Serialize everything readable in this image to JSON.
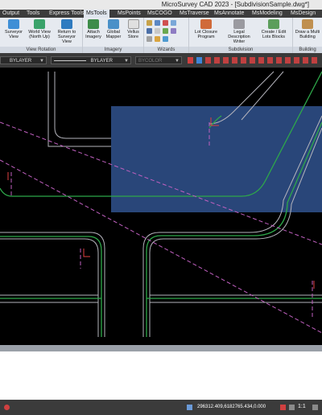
{
  "window": {
    "title": "MicroSurvey CAD 2023 - [SubdivisionSample.dwg*]"
  },
  "ribbon_tabs": [
    "Output",
    "Tools",
    "Express Tools",
    "MsTools",
    "MsPoints",
    "MsCOGO",
    "MsTraverse",
    "MsAnnotate",
    "MsModeling",
    "MsDesign"
  ],
  "active_tab": "MsTools",
  "ribbon": {
    "view_rotation": {
      "title": "View Rotation",
      "buttons": [
        "Surveyor View",
        "World View (North Up)",
        "Return to Surveyor View"
      ]
    },
    "imagery": {
      "title": "Imagery",
      "buttons": [
        "Attach Imagery",
        "Global Mapper",
        "Vellus Store"
      ]
    },
    "wizards": {
      "title": "Wizards"
    },
    "subdivision": {
      "title": "Subdivision",
      "buttons": [
        "Lot Closure Program",
        "Legal Description Writer",
        "Create / Edit Lots Blocks"
      ]
    },
    "building": {
      "title": "Building",
      "buttons": [
        "Draw a Multi Building"
      ]
    }
  },
  "properties": {
    "layer": "BYLAYER",
    "linetype": "BYLAYER",
    "color": "BYCOLOR"
  },
  "status": {
    "coordinates": "296312.409,6182765.434,0.000",
    "scale": "1:1"
  },
  "colors": {
    "background": "#000000",
    "selection": "#2b4a80",
    "lot_line": "#2ea84a",
    "road": "#b0b0b8",
    "dashed": "#c060c0"
  }
}
